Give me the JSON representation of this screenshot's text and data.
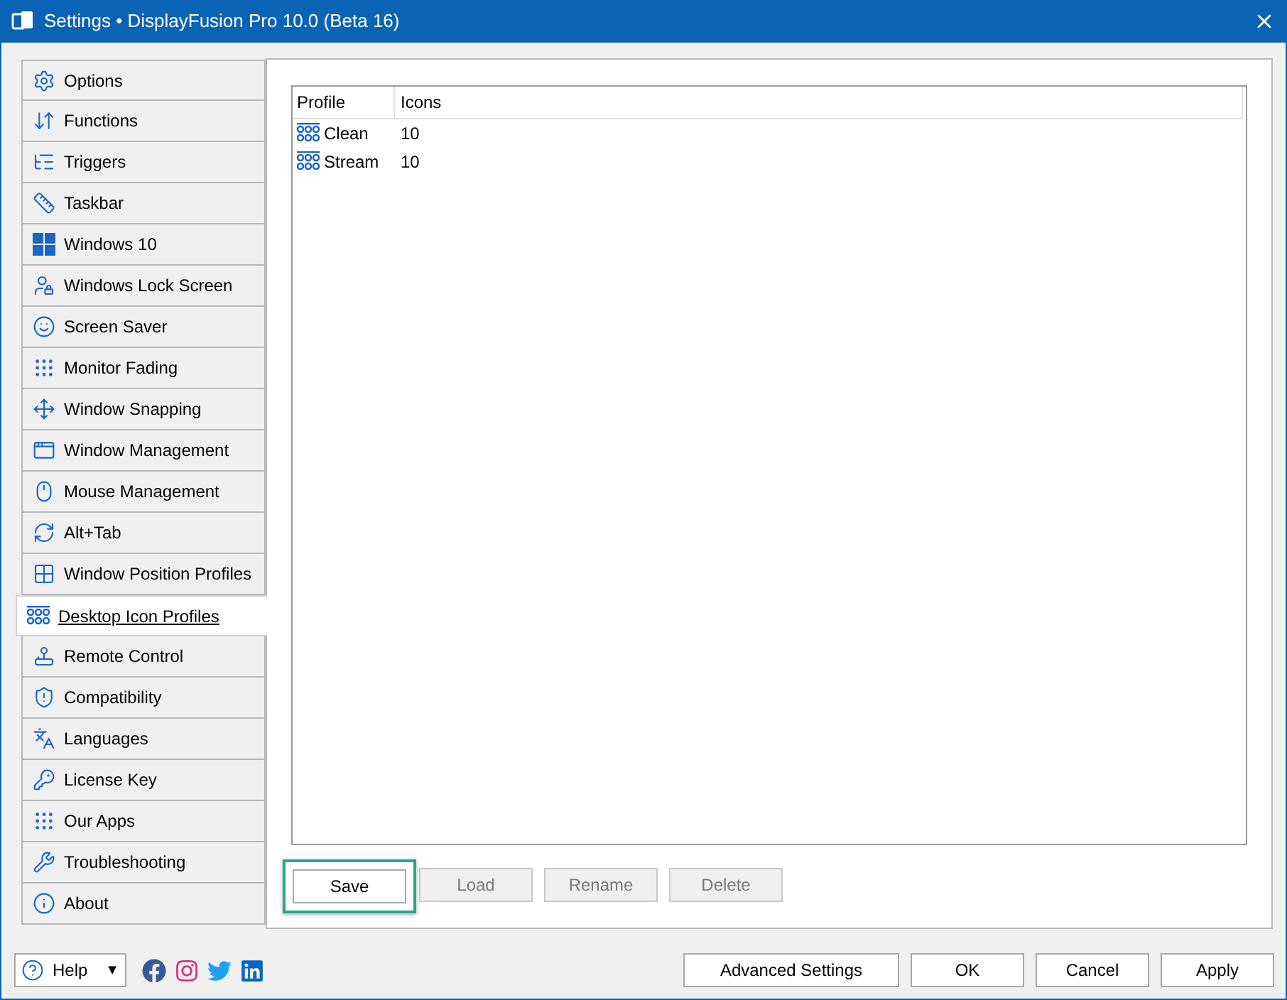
{
  "window": {
    "title": "Settings • DisplayFusion Pro 10.0 (Beta 16)"
  },
  "sidebar": {
    "items": [
      {
        "label": "Options",
        "selected": false
      },
      {
        "label": "Functions",
        "selected": false
      },
      {
        "label": "Triggers",
        "selected": false
      },
      {
        "label": "Taskbar",
        "selected": false
      },
      {
        "label": "Windows 10",
        "selected": false
      },
      {
        "label": "Windows Lock Screen",
        "selected": false
      },
      {
        "label": "Screen Saver",
        "selected": false
      },
      {
        "label": "Monitor Fading",
        "selected": false
      },
      {
        "label": "Window Snapping",
        "selected": false
      },
      {
        "label": "Window Management",
        "selected": false
      },
      {
        "label": "Mouse Management",
        "selected": false
      },
      {
        "label": "Alt+Tab",
        "selected": false
      },
      {
        "label": "Window Position Profiles",
        "selected": false
      },
      {
        "label": "Desktop Icon Profiles",
        "selected": true
      },
      {
        "label": "Remote Control",
        "selected": false
      },
      {
        "label": "Compatibility",
        "selected": false
      },
      {
        "label": "Languages",
        "selected": false
      },
      {
        "label": "License Key",
        "selected": false
      },
      {
        "label": "Our Apps",
        "selected": false
      },
      {
        "label": "Troubleshooting",
        "selected": false
      },
      {
        "label": "About",
        "selected": false
      }
    ]
  },
  "table": {
    "columns": [
      "Profile",
      "Icons"
    ],
    "rows": [
      {
        "profile": "Clean",
        "icons": "10"
      },
      {
        "profile": "Stream",
        "icons": "10"
      }
    ]
  },
  "actions": [
    {
      "label": "Save",
      "disabled": false,
      "focused": true
    },
    {
      "label": "Load",
      "disabled": true,
      "focused": false
    },
    {
      "label": "Rename",
      "disabled": true,
      "focused": false
    },
    {
      "label": "Delete",
      "disabled": true,
      "focused": false
    }
  ],
  "footer": {
    "help": {
      "label": "Help",
      "caret": "▼"
    },
    "buttons": [
      "Advanced Settings",
      "OK",
      "Cancel",
      "Apply"
    ]
  }
}
